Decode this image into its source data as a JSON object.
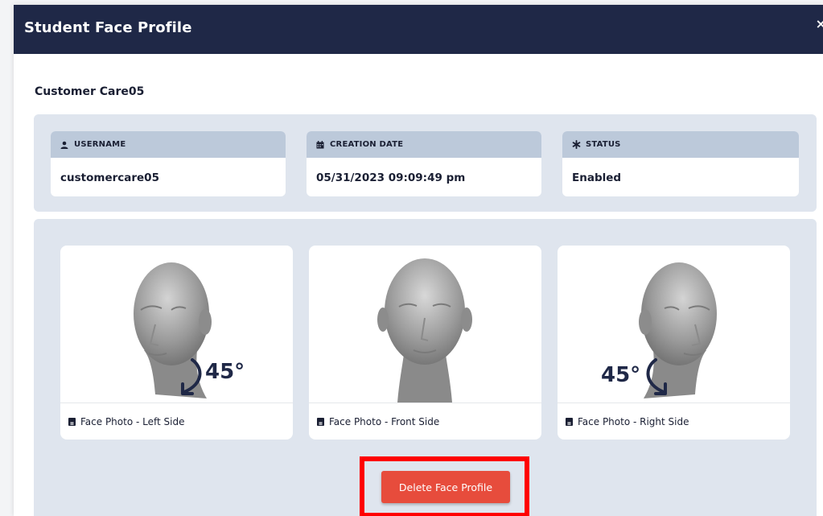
{
  "modal": {
    "title": "Student Face Profile",
    "close_label": "×"
  },
  "student": {
    "name": "Customer Care05"
  },
  "info": {
    "username": {
      "label": "USERNAME",
      "value": "customercare05",
      "icon": "user-icon"
    },
    "creation_date": {
      "label": "CREATION DATE",
      "value": "05/31/2023 09:09:49 pm",
      "icon": "calendar-icon"
    },
    "status": {
      "label": "STATUS",
      "value": "Enabled",
      "icon": "asterisk-icon"
    }
  },
  "photos": [
    {
      "caption": "Face Photo - Left Side",
      "angle": "45°",
      "icon": "id-card-icon"
    },
    {
      "caption": "Face Photo - Front Side",
      "icon": "id-card-icon"
    },
    {
      "caption": "Face Photo - Right Side",
      "angle": "45°",
      "icon": "id-card-icon"
    }
  ],
  "actions": {
    "delete_label": "Delete Face Profile"
  },
  "colors": {
    "header": "#1f2847",
    "panel": "#dfe5ee",
    "label_bar": "#bcc9da",
    "delete_button": "#e74c3c",
    "highlight": "#ff0000"
  }
}
